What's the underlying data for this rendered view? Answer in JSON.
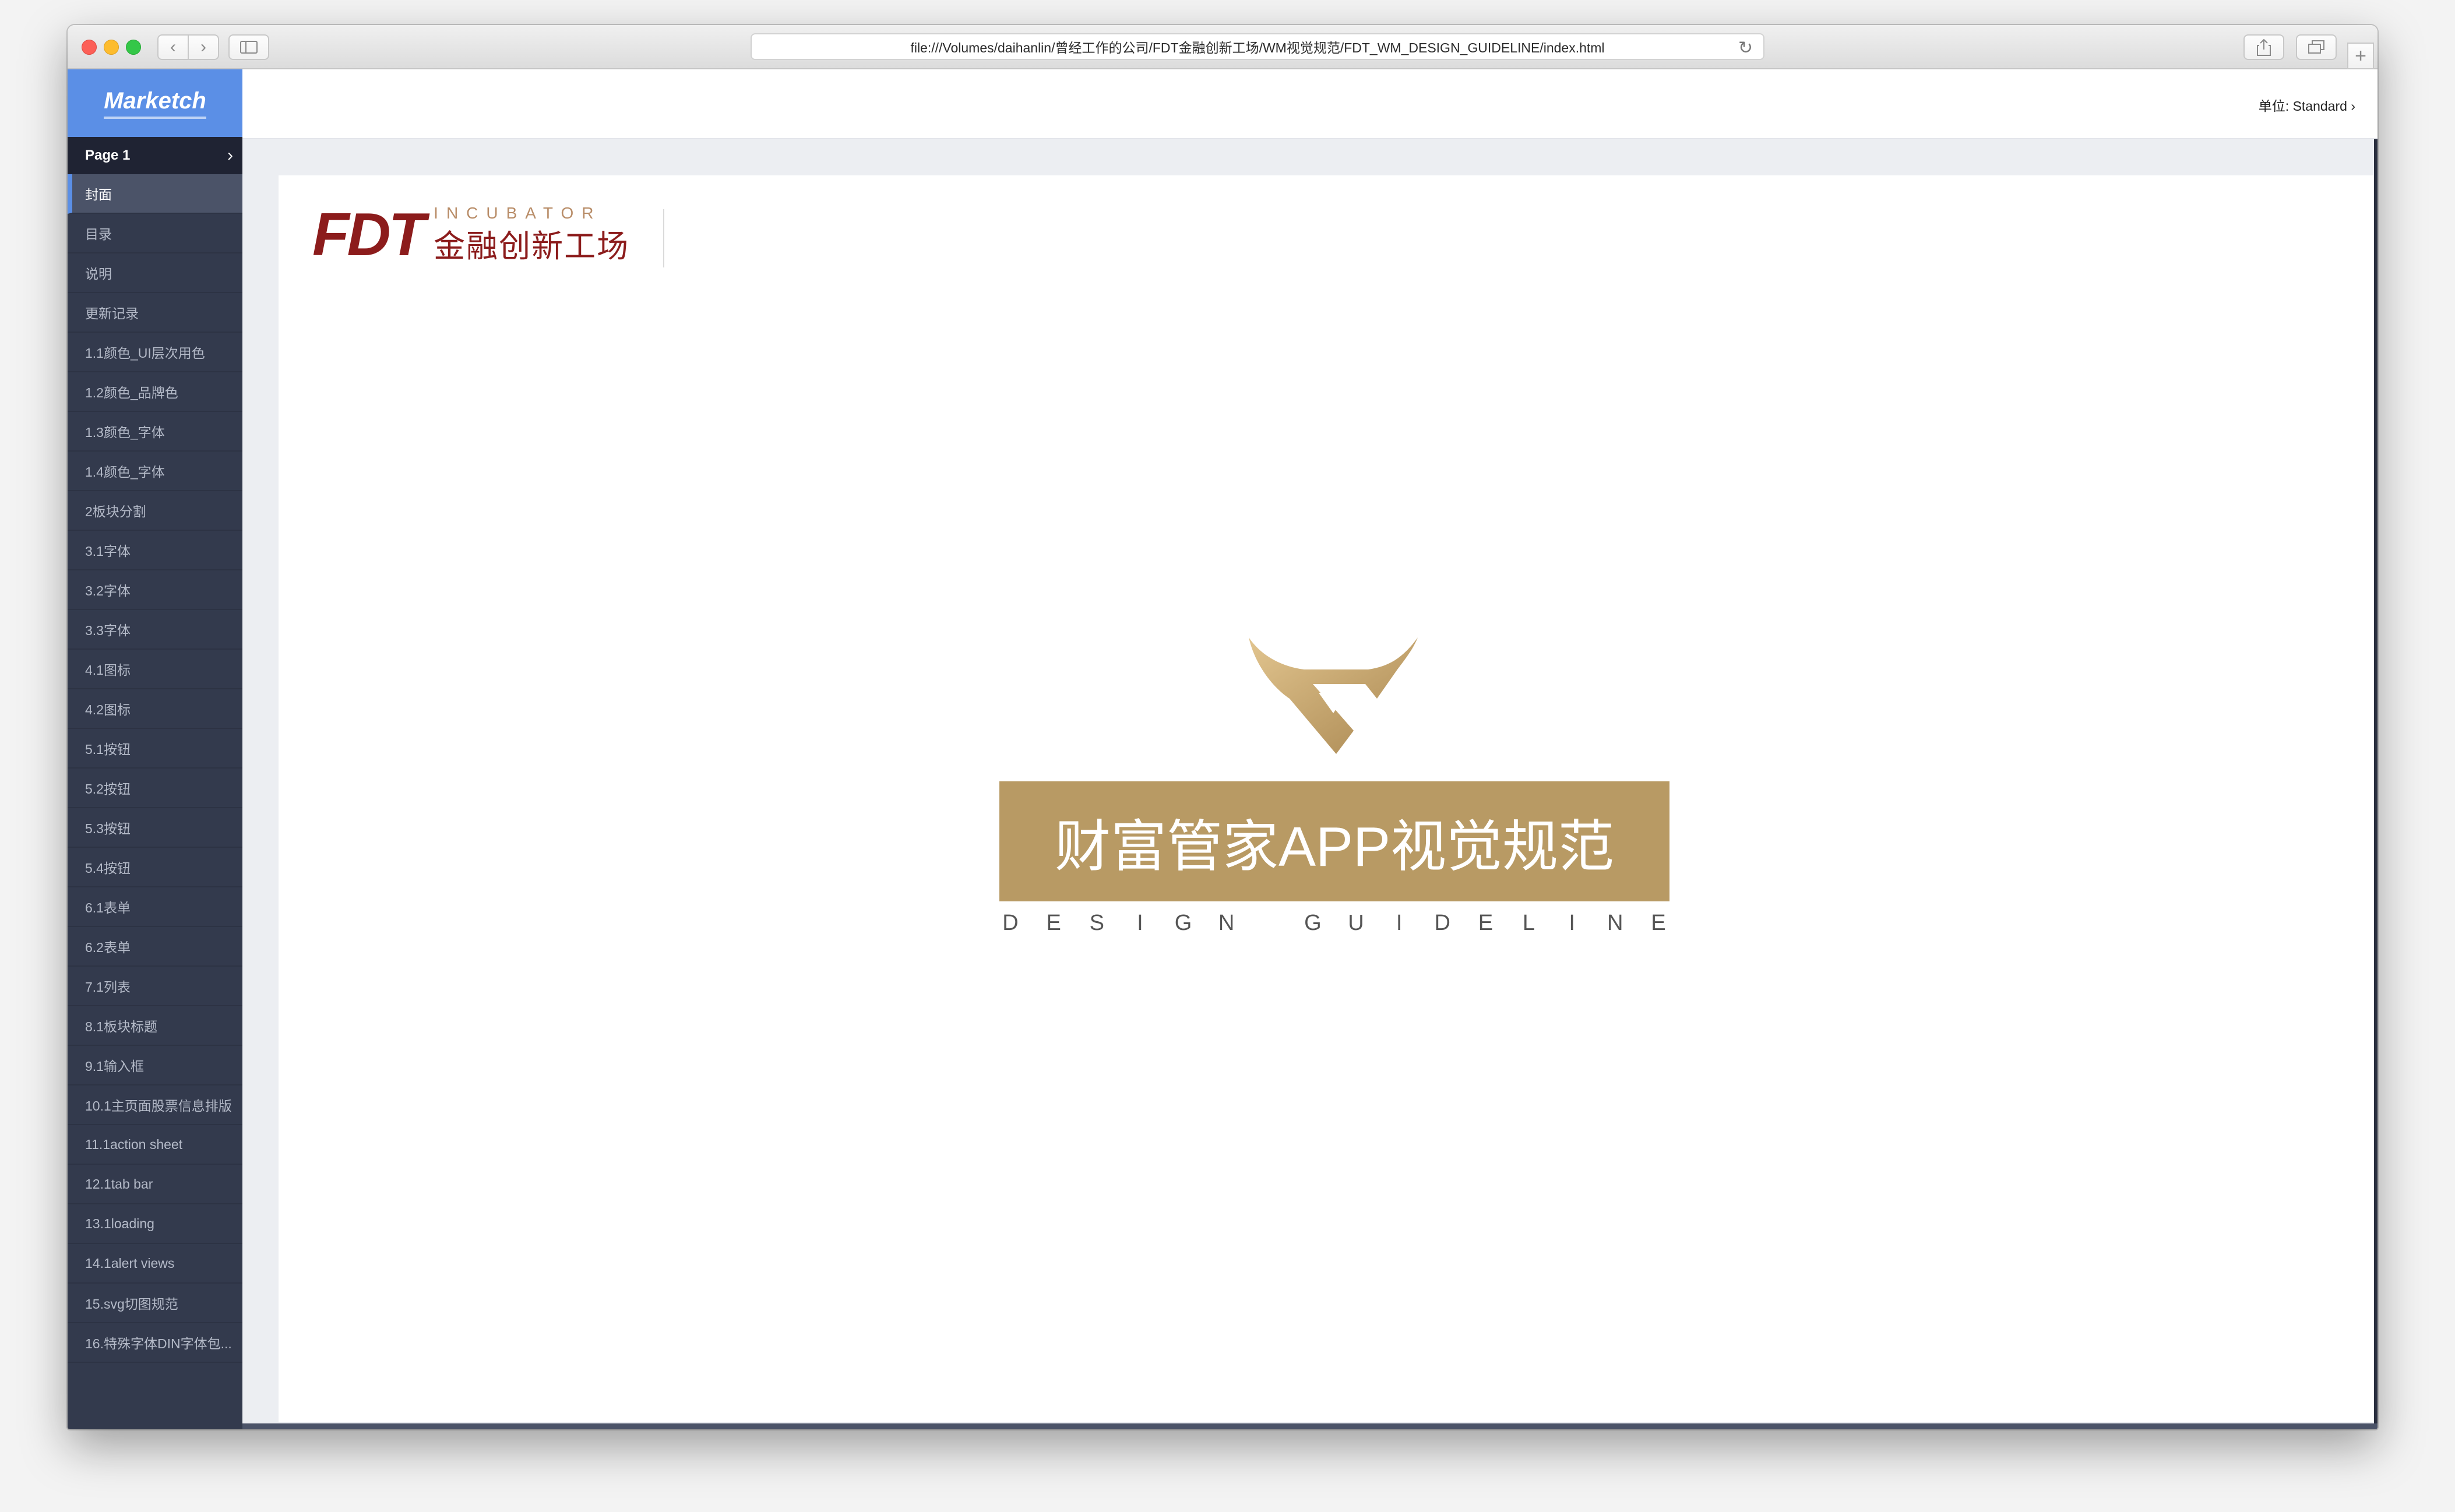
{
  "browser": {
    "url": "file:///Volumes/daihanlin/曾经工作的公司/FDT金融创新工场/WM视觉规范/FDT_WM_DESIGN_GUIDELINE/index.html"
  },
  "sidebar": {
    "brand": "Marketch",
    "page_label": "Page 1",
    "items": [
      "封面",
      "目录",
      "说明",
      "更新记录",
      "1.1颜色_UI层次用色",
      "1.2颜色_品牌色",
      "1.3颜色_字体",
      "1.4颜色_字体",
      "2板块分割",
      "3.1字体",
      "3.2字体",
      "3.3字体",
      "4.1图标",
      "4.2图标",
      "5.1按钮",
      "5.2按钮",
      "5.3按钮",
      "5.4按钮",
      "6.1表单",
      "6.2表单",
      "7.1列表",
      "8.1板块标题",
      "9.1输入框",
      "10.1主页面股票信息排版",
      "11.1action sheet",
      "12.1tab bar",
      "13.1loading",
      "14.1alert views",
      "15.svg切图规范",
      "16.特殊字体DIN字体包..."
    ],
    "active_index": 0
  },
  "header": {
    "unit_label": "单位:",
    "unit_value": "Standard",
    "unit_chevron": "›"
  },
  "artboard": {
    "logo_mark": "FDT",
    "logo_incubator": "INCUBATOR",
    "logo_chinese": "金融创新工场",
    "title": "财富管家APP视觉规范",
    "subtitle_letters": [
      "D",
      "E",
      "S",
      "I",
      "G",
      "N",
      " ",
      "G",
      "U",
      "I",
      "D",
      "E",
      "L",
      "I",
      "N",
      "E"
    ]
  },
  "colors": {
    "brand_blue": "#5b8fe6",
    "sidebar_bg": "#333a4d",
    "fdt_red": "#8c1c1c",
    "gold": "#b89a64"
  }
}
